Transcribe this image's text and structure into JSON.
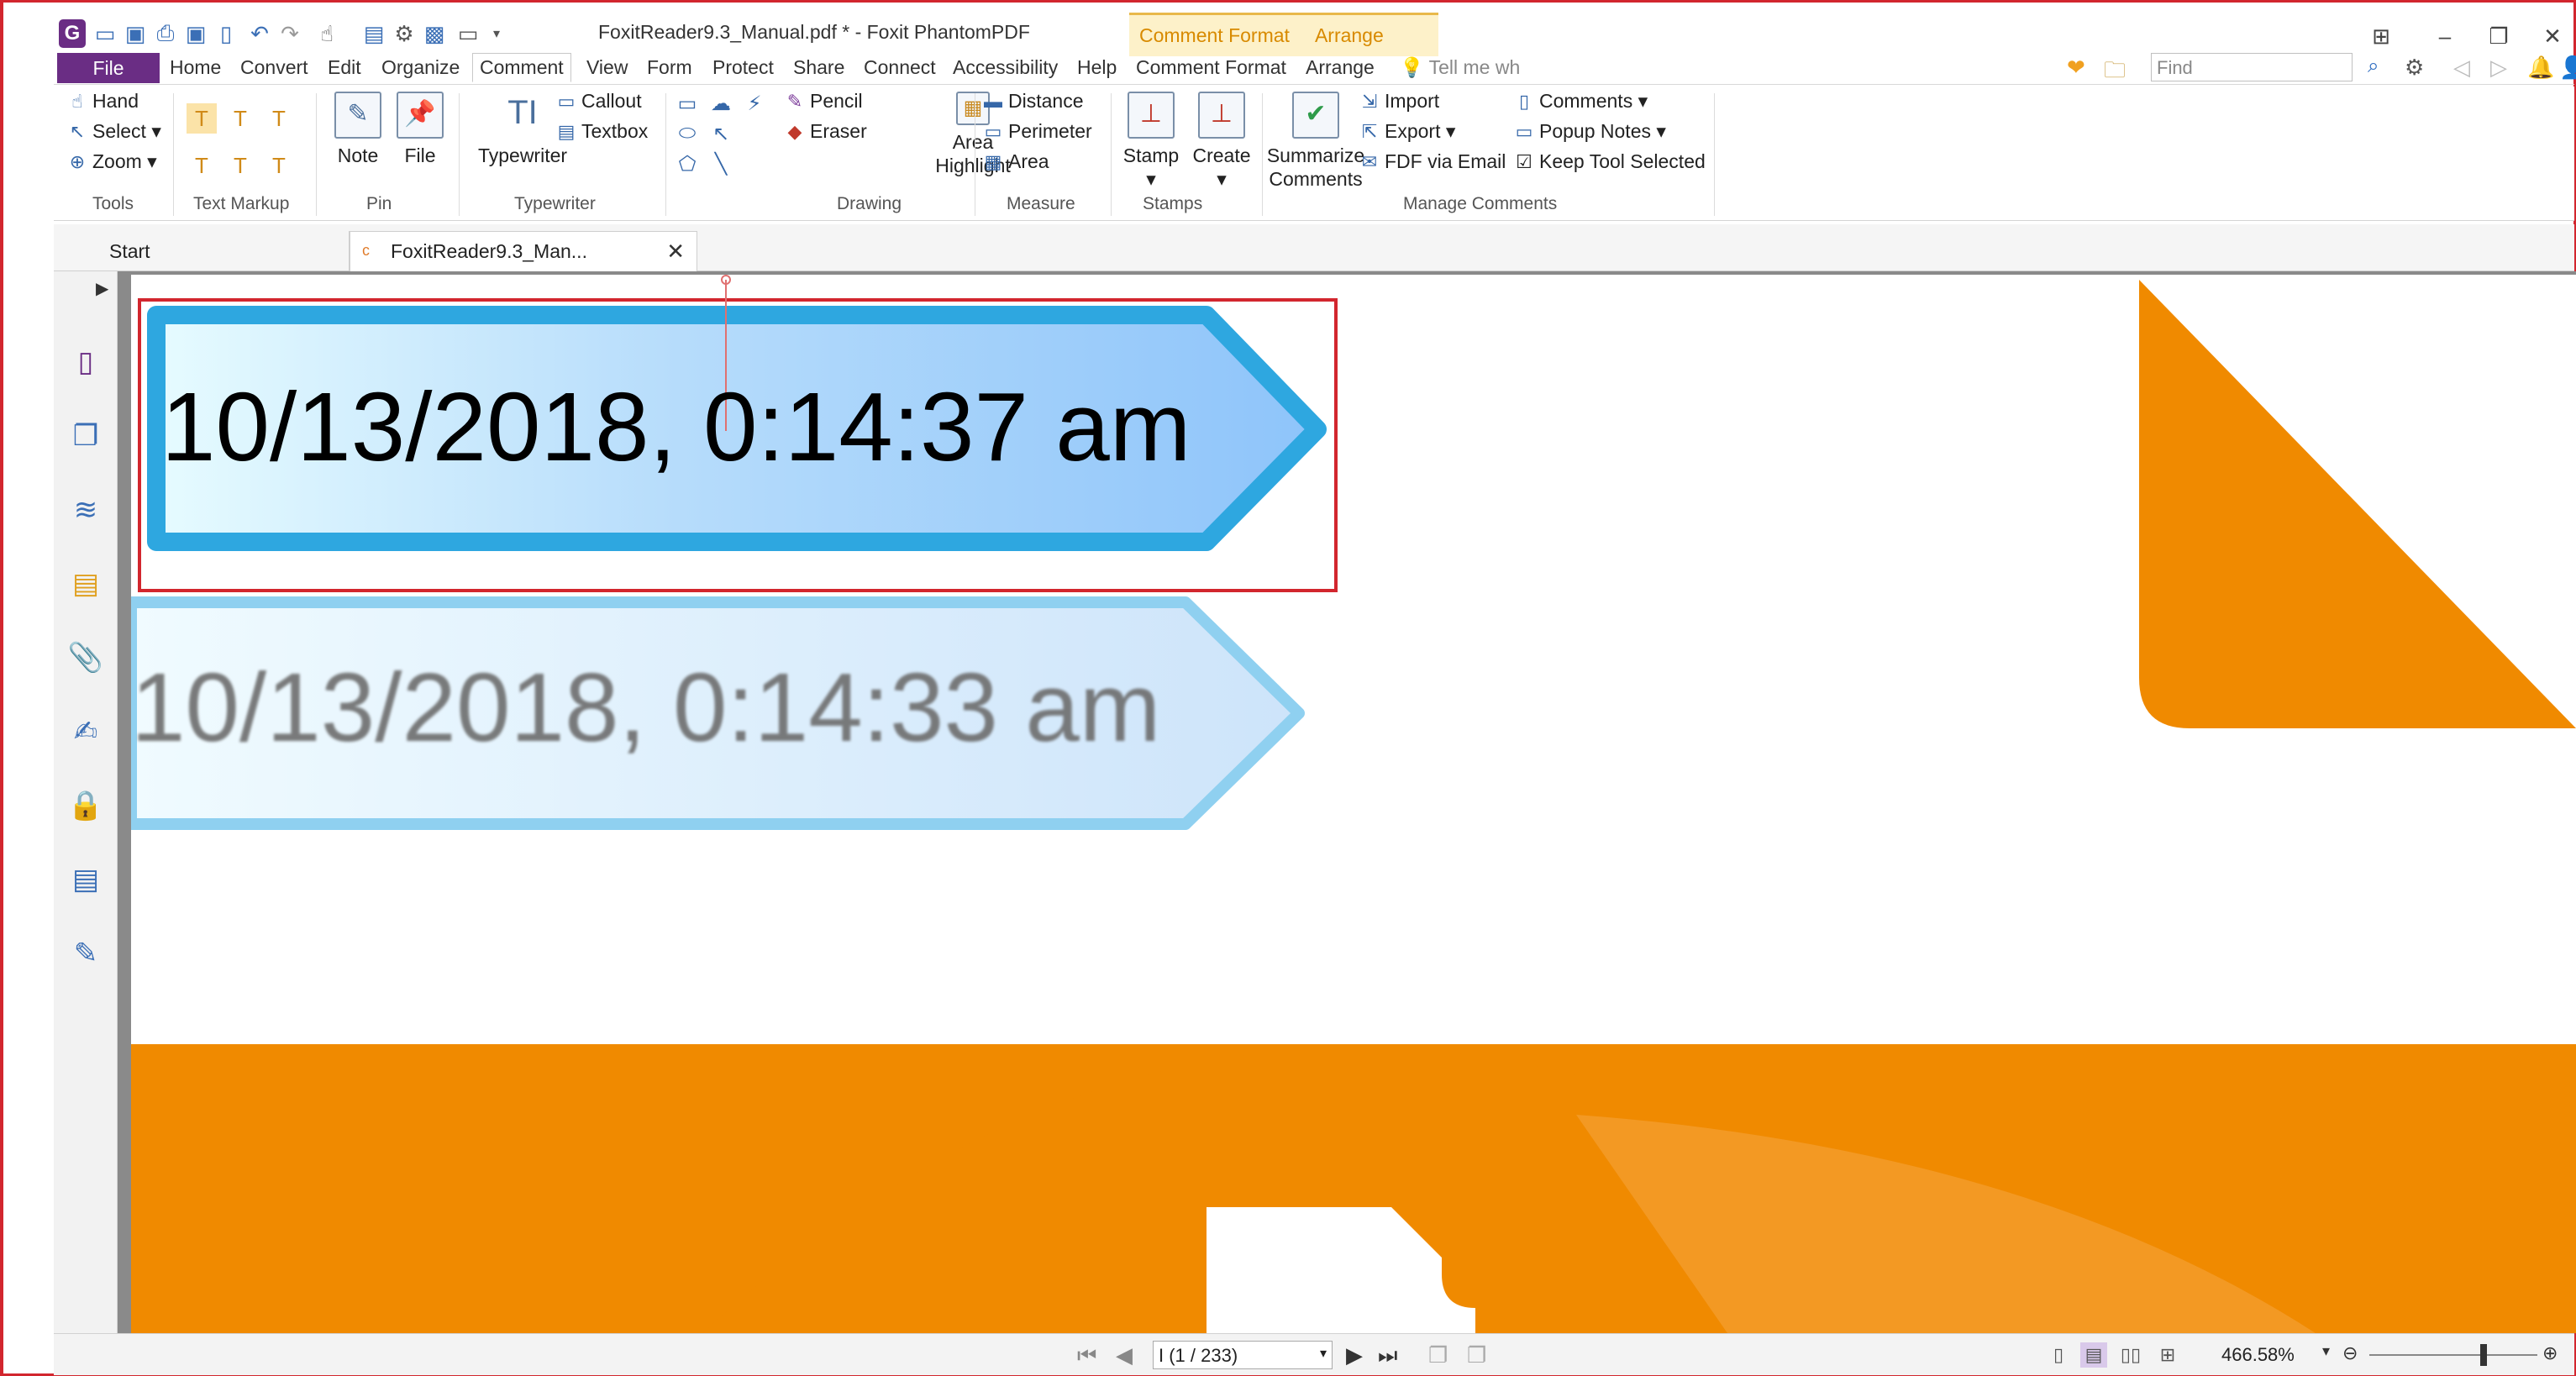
{
  "window": {
    "title": "FoxitReader9.3_Manual.pdf * - Foxit PhantomPDF",
    "context_tabs": [
      "Comment Format",
      "Arrange"
    ]
  },
  "menu": {
    "file": "File",
    "tabs": [
      "Home",
      "Convert",
      "Edit",
      "Organize",
      "Comment",
      "View",
      "Form",
      "Protect",
      "Share",
      "Connect",
      "Accessibility",
      "Help",
      "Comment Format",
      "Arrange"
    ],
    "active_tab": "Comment",
    "tell_me": "Tell me wh",
    "find_placeholder": "Find"
  },
  "ribbon": {
    "tools": {
      "hand": "Hand",
      "select": "Select",
      "zoom": "Zoom",
      "label": "Tools"
    },
    "text_markup": {
      "label": "Text Markup"
    },
    "pin": {
      "note": "Note",
      "file": "File",
      "label": "Pin"
    },
    "typewriter": {
      "typewriter": "Typewriter",
      "callout": "Callout",
      "textbox": "Textbox",
      "label": "Typewriter"
    },
    "drawing": {
      "pencil": "Pencil",
      "eraser": "Eraser",
      "area_highlight_1": "Area",
      "area_highlight_2": "Highlight",
      "label": "Drawing"
    },
    "measure": {
      "distance": "Distance",
      "perimeter": "Perimeter",
      "area": "Area",
      "label": "Measure"
    },
    "stamps": {
      "stamp": "Stamp",
      "create": "Create",
      "label": "Stamps"
    },
    "manage": {
      "summarize_1": "Summarize",
      "summarize_2": "Comments",
      "import": "Import",
      "export": "Export",
      "fdf_email": "FDF via Email",
      "comments": "Comments",
      "popup_notes": "Popup Notes",
      "keep_tool": "Keep Tool Selected",
      "label": "Manage Comments"
    }
  },
  "doc_tabs": {
    "start": "Start",
    "document": "FoxitReader9.3_Man..."
  },
  "document": {
    "stamp_selected": "10/13/2018, 0:14:37 am",
    "stamp_preview": "10/13/2018, 0:14:33 am"
  },
  "status": {
    "page_indicator": "I (1 / 233)",
    "zoom": "466.58%"
  },
  "colors": {
    "brand": "#6a2d84",
    "accent_orange": "#f08a00",
    "stamp_blue": "#2ea7e0",
    "selection_red": "#d2262e"
  }
}
